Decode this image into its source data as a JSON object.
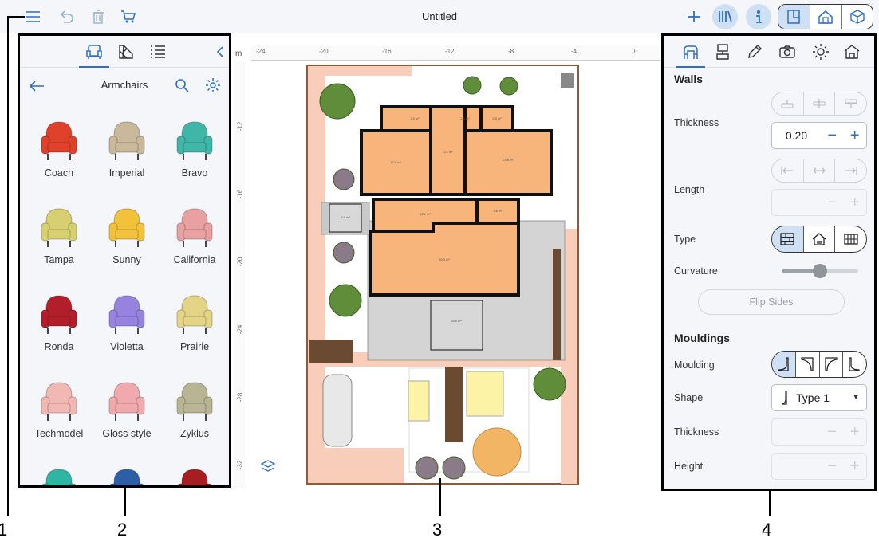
{
  "toolbar": {
    "title": "Untitled",
    "left_icons": [
      "menu-icon",
      "undo-icon",
      "trash-icon",
      "cart-icon"
    ],
    "right_icons": [
      "plus-icon",
      "library-icon",
      "info-icon"
    ],
    "view_modes": [
      "plan-2d-icon",
      "floor-icon",
      "view-3d-icon"
    ],
    "accent": "#2d6fc5"
  },
  "left_panel": {
    "tabs": [
      "armchair-icon",
      "materials-icon",
      "list-icon",
      "collapse-icon"
    ],
    "category": "Armchairs",
    "items": [
      {
        "label": "Coach",
        "color": "#e0412b"
      },
      {
        "label": "Imperial",
        "color": "#c9b99a"
      },
      {
        "label": "Bravo",
        "color": "#3fb6a8"
      },
      {
        "label": "Tampa",
        "color": "#d8d070"
      },
      {
        "label": "Sunny",
        "color": "#f2c33a"
      },
      {
        "label": "California",
        "color": "#e9a0a0"
      },
      {
        "label": "Ronda",
        "color": "#b21f2a"
      },
      {
        "label": "Violetta",
        "color": "#9683e0"
      },
      {
        "label": "Prairie",
        "color": "#e4d486"
      },
      {
        "label": "Techmodel",
        "color": "#f2b9b4"
      },
      {
        "label": "Gloss style",
        "color": "#f0a9ad"
      },
      {
        "label": "Zyklus",
        "color": "#b9b494"
      },
      {
        "label": "",
        "color": "#2fb5a3"
      },
      {
        "label": "",
        "color": "#2d5fa8"
      },
      {
        "label": "",
        "color": "#a61e22"
      }
    ]
  },
  "canvas": {
    "unit": "m",
    "ruler_top": [
      "-24",
      "-20",
      "-16",
      "-12",
      "-8",
      "-4",
      "0"
    ],
    "ruler_left": [
      "-12",
      "-16",
      "-20",
      "-24",
      "-28",
      "-32"
    ],
    "rooms": [
      {
        "label": "3.9 m²"
      },
      {
        "label": "2.5 m²"
      },
      {
        "label": "2.5 m²"
      },
      {
        "label": "14.6 m²"
      },
      {
        "label": "13.1 m²"
      },
      {
        "label": "23.8 m²"
      },
      {
        "label": "5.6 m²"
      },
      {
        "label": "12.1 m²"
      },
      {
        "label": "3.6 m²"
      },
      {
        "label": "30.3 m²"
      },
      {
        "label": "38.6 m²"
      }
    ]
  },
  "right_panel": {
    "tabs": [
      "wall-tool-icon",
      "paint-icon",
      "pencil-icon",
      "camera-icon",
      "sun-icon",
      "house-icon"
    ],
    "walls_title": "Walls",
    "thickness_label": "Thickness",
    "thickness_value": "0.20",
    "length_label": "Length",
    "type_label": "Type",
    "curvature_label": "Curvature",
    "curvature_fraction": 0.5,
    "flip_label": "Flip Sides",
    "mouldings_title": "Mouldings",
    "moulding_label": "Moulding",
    "shape_label": "Shape",
    "shape_value": "Type 1",
    "m_thickness_label": "Thickness",
    "height_label": "Height"
  },
  "callouts": [
    "1",
    "2",
    "3",
    "4"
  ]
}
